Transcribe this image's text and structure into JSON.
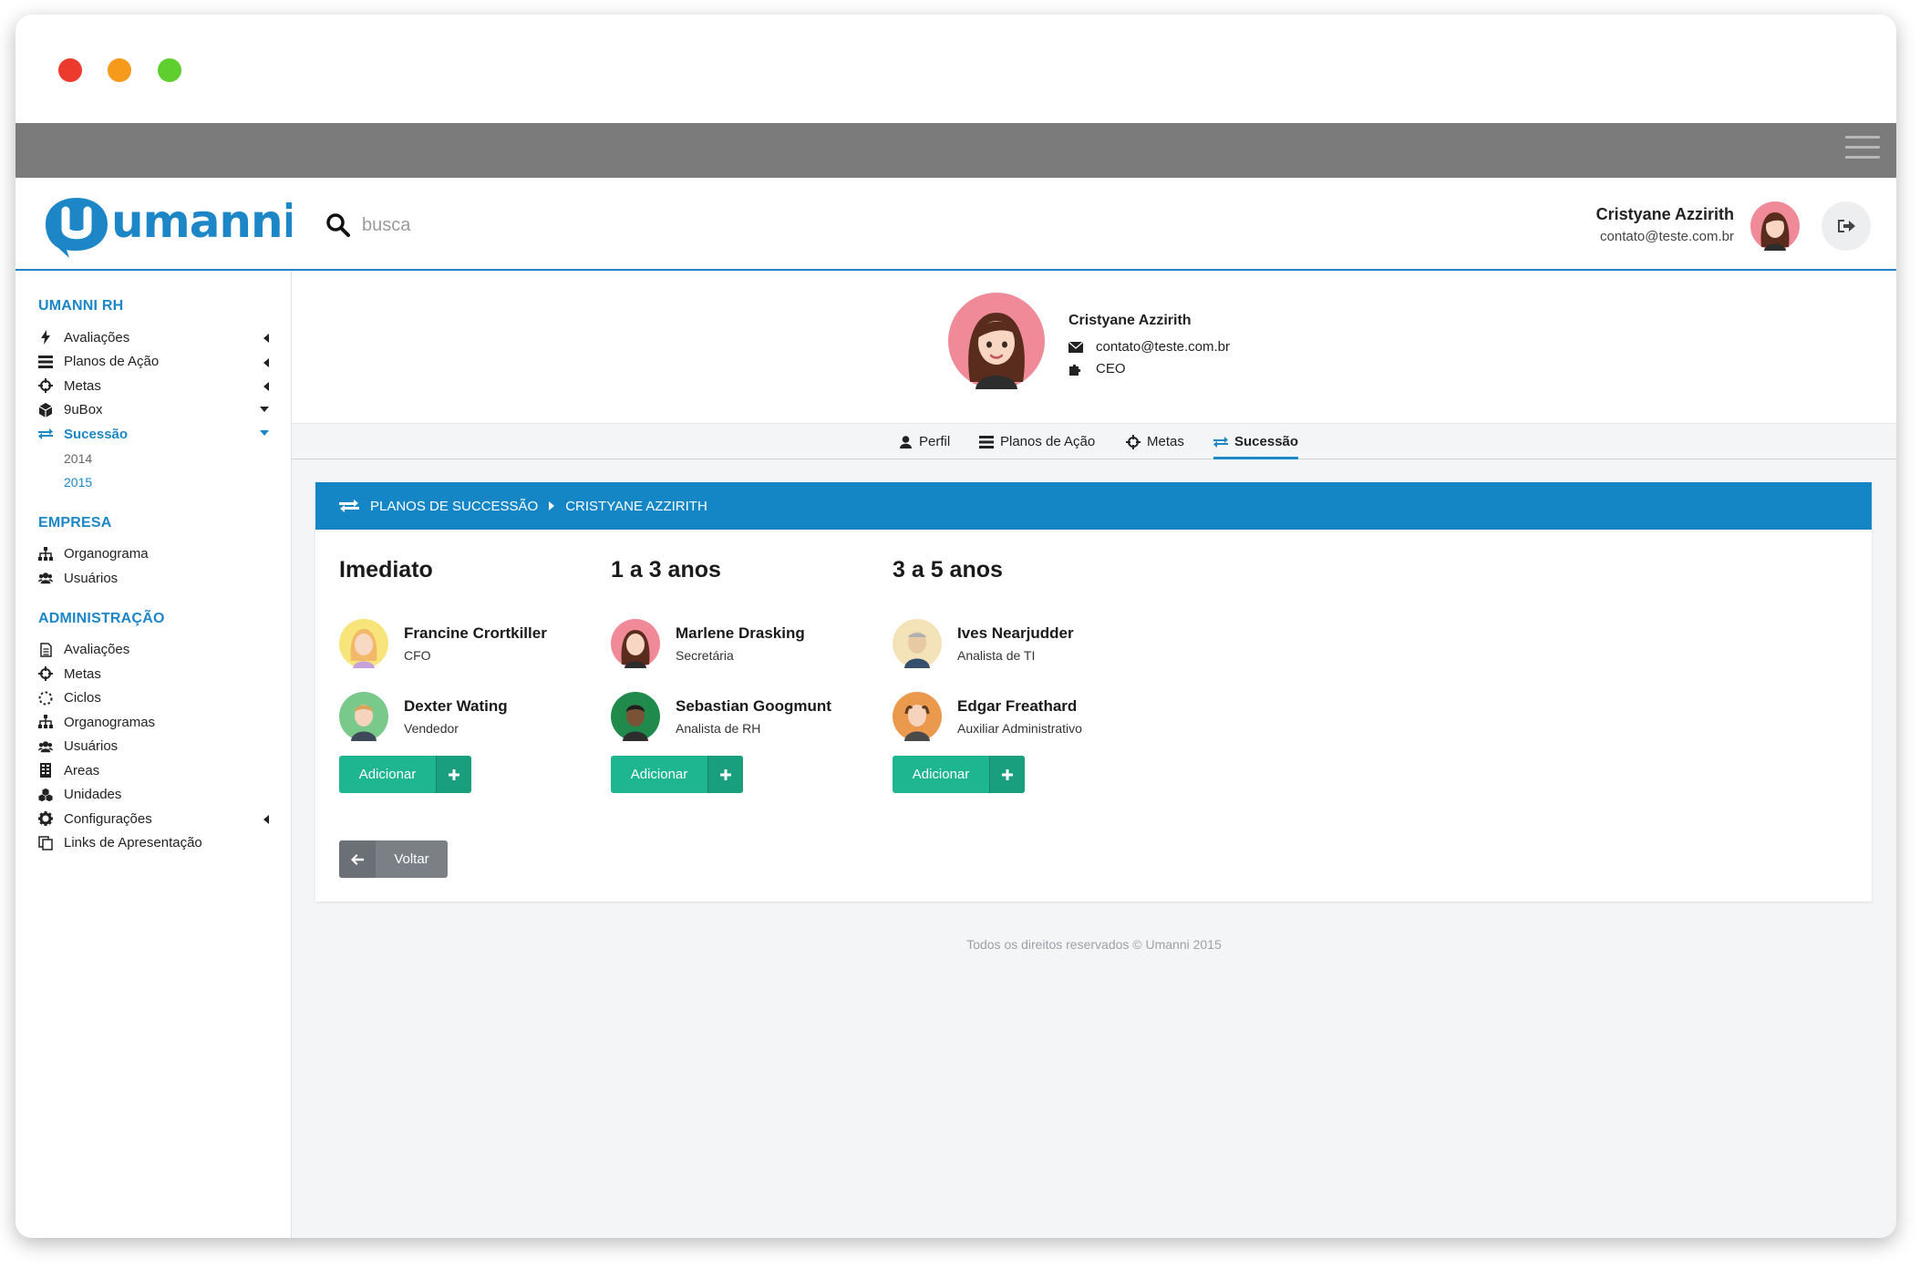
{
  "brand": {
    "logo_text": "umanni",
    "accent": "#1c86c7",
    "success": "#1eb591"
  },
  "search": {
    "placeholder": "busca"
  },
  "user": {
    "name": "Cristyane Azzirith",
    "email": "contato@teste.com.br"
  },
  "sidebar": {
    "sections": [
      {
        "title": "UMANNI RH",
        "items": [
          {
            "label": "Avaliações",
            "icon": "bolt-icon"
          },
          {
            "label": "Planos de Ação",
            "icon": "list-icon"
          },
          {
            "label": "Metas",
            "icon": "crosshairs-icon"
          },
          {
            "label": "9uBox",
            "icon": "cube-icon"
          },
          {
            "label": "Sucessão",
            "icon": "exchange-icon"
          }
        ],
        "sub_items": [
          "2014",
          "2015"
        ]
      },
      {
        "title": "EMPRESA",
        "items": [
          {
            "label": "Organograma",
            "icon": "sitemap-icon"
          },
          {
            "label": "Usuários",
            "icon": "users-icon"
          }
        ]
      },
      {
        "title": "ADMINISTRAÇÃO",
        "items": [
          {
            "label": "Avaliações",
            "icon": "document-icon"
          },
          {
            "label": "Metas",
            "icon": "crosshairs-icon"
          },
          {
            "label": "Ciclos",
            "icon": "circle-dashed-icon"
          },
          {
            "label": "Organogramas",
            "icon": "sitemap-icon"
          },
          {
            "label": "Usuários",
            "icon": "users-icon"
          },
          {
            "label": "Areas",
            "icon": "building-icon"
          },
          {
            "label": "Unidades",
            "icon": "cubes-icon"
          },
          {
            "label": "Configurações",
            "icon": "gear-icon"
          },
          {
            "label": "Links de Apresentação",
            "icon": "copy-icon"
          }
        ]
      }
    ]
  },
  "profile": {
    "name": "Cristyane Azzirith",
    "email": "contato@teste.com.br",
    "role": "CEO"
  },
  "tabs": [
    {
      "label": "Perfil",
      "icon": "user-icon"
    },
    {
      "label": "Planos de Ação",
      "icon": "list-icon"
    },
    {
      "label": "Metas",
      "icon": "crosshairs-icon"
    },
    {
      "label": "Sucessão",
      "icon": "exchange-icon",
      "active": true
    }
  ],
  "breadcrumb": {
    "section": "PLANOS DE SUCCESSÃO",
    "current": "CRISTYANE AZZIRITH"
  },
  "columns": [
    {
      "title": "Imediato",
      "people": [
        {
          "name": "Francine Crortkiller",
          "role": "CFO"
        },
        {
          "name": "Dexter Wating",
          "role": "Vendedor"
        }
      ]
    },
    {
      "title": "1 a 3 anos",
      "people": [
        {
          "name": "Marlene Drasking",
          "role": "Secretária"
        },
        {
          "name": "Sebastian Googmunt",
          "role": "Analista de RH"
        }
      ]
    },
    {
      "title": "3 a 5 anos",
      "people": [
        {
          "name": "Ives Nearjudder",
          "role": "Analista de TI"
        },
        {
          "name": "Edgar Freathard",
          "role": "Auxiliar Administrativo"
        }
      ]
    }
  ],
  "buttons": {
    "add": "Adicionar",
    "back": "Voltar"
  },
  "footer": {
    "text": "Todos os direitos reservados © Umanni 2015"
  }
}
